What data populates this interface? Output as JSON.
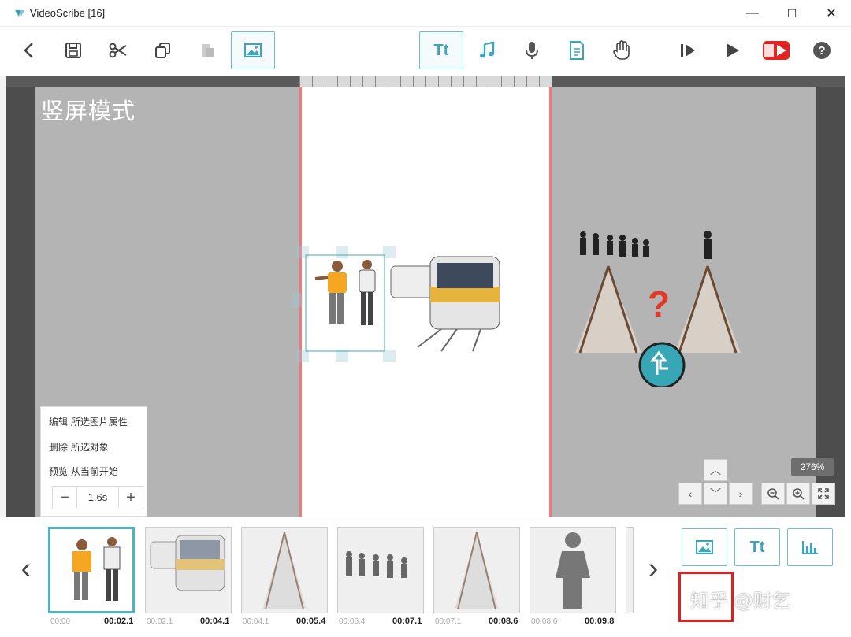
{
  "window": {
    "title": "VideoScribe [16]",
    "minimize": "—",
    "maximize": "☐",
    "close": "✕"
  },
  "toolbar": {
    "text_tool_label": "Tt",
    "icons": [
      "back-icon",
      "save-icon",
      "cut-icon",
      "copy-icon",
      "paste-icon",
      "image-icon",
      "text-icon",
      "music-icon",
      "microphone-icon",
      "document-icon",
      "hand-icon",
      "preview-step-icon",
      "play-icon",
      "publish-icon",
      "help-icon"
    ]
  },
  "canvas": {
    "mode_label": "竖屏模式",
    "zoom": "276%"
  },
  "context_menu": {
    "edit": "编辑 所选图片属性",
    "delete": "删除 所选对象",
    "preview": "预览 从当前开始",
    "duration": "1.6s",
    "minus": "−",
    "plus": "+"
  },
  "timeline": {
    "prev": "‹",
    "next": "›",
    "thumbs": [
      {
        "start": "00:00",
        "end": "00:02.1"
      },
      {
        "start": "00:02.1",
        "end": "00:04.1"
      },
      {
        "start": "00:04.1",
        "end": "00:05.4"
      },
      {
        "start": "00:05.4",
        "end": "00:07.1"
      },
      {
        "start": "00:07.1",
        "end": "00:08.6"
      },
      {
        "start": "00:08.6",
        "end": "00:09.8"
      }
    ],
    "add_text_label": "Tt"
  },
  "watermark": "知乎 @财乞",
  "colors": {
    "accent": "#4fb3c2",
    "page_border": "#f07a7a",
    "workspace": "#b4b4b4",
    "highlight": "#e02020"
  }
}
